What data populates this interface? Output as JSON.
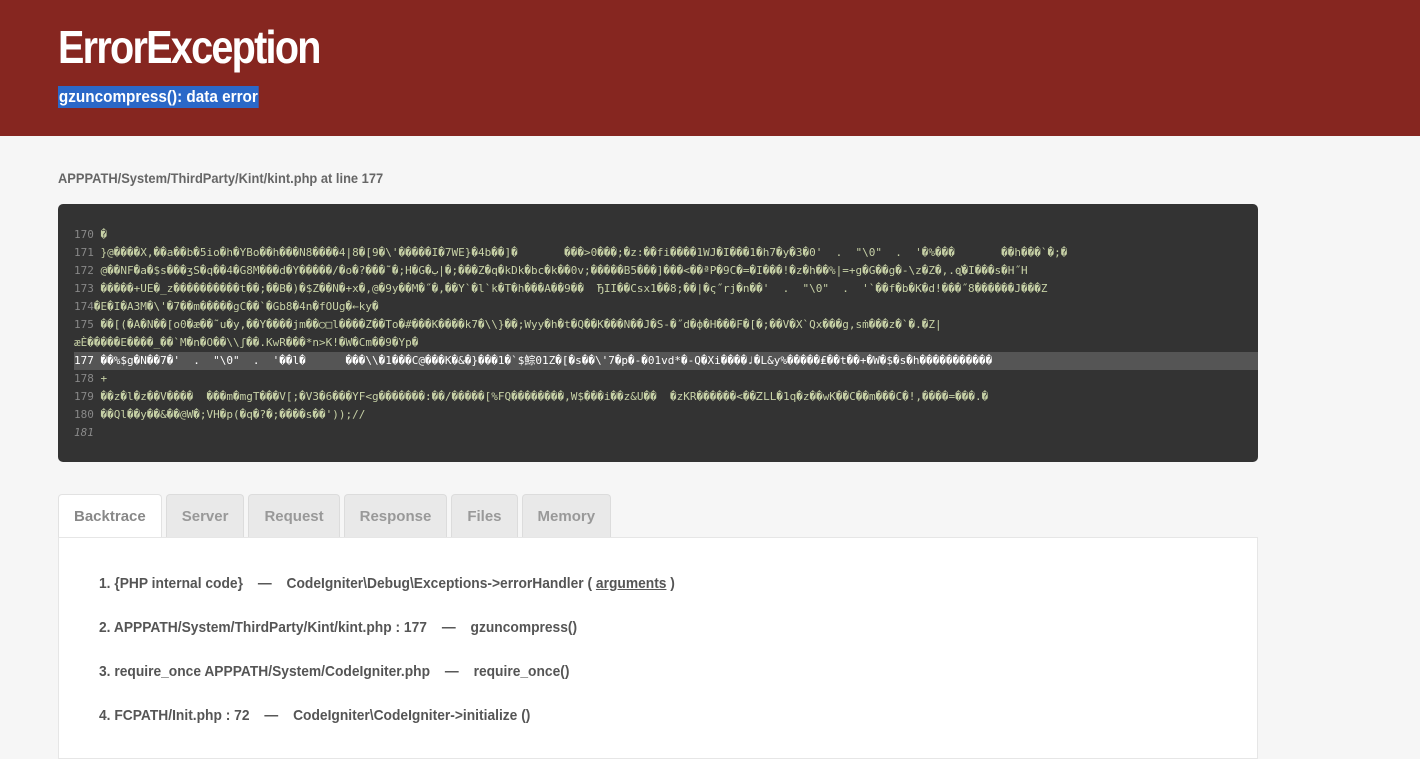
{
  "header": {
    "title": "ErrorException",
    "message": "gzuncompress(): data error"
  },
  "source": {
    "path": "APPPATH/System/ThirdParty/Kint/kint.php at line 177",
    "lines": [
      {
        "num": "170",
        "code": "�"
      },
      {
        "num": "171",
        "code": "}@����X,��a��b�5io�h�YBo��h���N8����4|8�[9�\\'�����I�7WE}�4b��]�       ���>0���;�z:��fi����1WJ�I���1�h7�y�3�0'  .  \"\\0\"  .  '�%���       ��h���`�;�"
      },
      {
        "num": "172",
        "code": "@��NF�a�$s���ʒS�q��4�G8M���d�Y�����/�o�?���˜�;H�G�ب|�;���Z�q�kDk�bc�k��0v;�����B5���]���<��ªP�9C�=�I���!�z�h��%|=+g�G��g�-\\z�Z�,.q҉�I���s�H˝H"
      },
      {
        "num": "173",
        "code": "�����+UE�_z����������t��;��B�)�$Z��N�+x�,@�9y��M�˝�,��Y`�l`k�T�h���A��9��  ЂII��Csx1��8;��|�ς˝rj�n��'  .  \"\\0\"  .  '`��f�b�K�d!���˝8������J���Z"
      },
      {
        "num": "174",
        "code": "�E�I�A3M�\\'�7��m�����gC��`�Gb8�4n�fOUg�←ky�"
      },
      {
        "num": "175",
        "code": "��[(�A�N��[o0�æ��˜u�y,��Y����jm��○□l����Z��To�#���K����k7�\\\\}��;Wyy�h�t�Q��K���N��J�S-�˝d�ф�H���F�[�;��V�X`Qx���g,sṁ���z�`�.�Z|"
      },
      {
        "num": "",
        "code": "æÈ�����E����_��`M�n�O��\\\\ʃ��.KwR���*n>K!�W�Cm��9�Yp�"
      },
      {
        "num": "177",
        "code": "��%$g�N��7�'  .  \"\\0\"  .  '��l�      ���\\\\�1���C@���K�&�}���1�`$鯮01Z�[�s��\\'7�p�-�01vd*�-Q�Xi����♩�L&y%�����₤��t��+�W�$�s�h�����������"
      },
      {
        "num": "178",
        "code": "+"
      },
      {
        "num": "179",
        "code": "��z�l�z��V����  ���m�mgT���V[;�V3�6���YF<g�������:��/�����[%FQ��������,W$���i��z&U��  �zKR������<��ᏃLL�1q�z��wK��C��m���C�!,����=���.�"
      },
      {
        "num": "180",
        "code": "��Ql��y��&��@W�;VH�p(�q�?�;����s��'));//"
      },
      {
        "num": "181",
        "code": ""
      }
    ]
  },
  "tabs": [
    {
      "label": "Backtrace",
      "active": true
    },
    {
      "label": "Server",
      "active": false
    },
    {
      "label": "Request",
      "active": false
    },
    {
      "label": "Response",
      "active": false
    },
    {
      "label": "Files",
      "active": false
    },
    {
      "label": "Memory",
      "active": false
    }
  ],
  "backtrace": [
    {
      "num": "1.",
      "file": "{PHP internal code}",
      "func": "CodeIgniter\\Debug\\Exceptions->errorHandler (",
      "link": "arguments",
      "tail": ")"
    },
    {
      "num": "2.",
      "file": "APPPATH/System/ThirdParty/Kint/kint.php : 177",
      "func": "gzuncompress()",
      "link": "",
      "tail": ""
    },
    {
      "num": "3.",
      "file": "require_once APPPATH/System/CodeIgniter.php",
      "func": "require_once()",
      "link": "",
      "tail": ""
    },
    {
      "num": "4.",
      "file": "FCPATH/Init.php : 72",
      "func": "CodeIgniter\\CodeIgniter->initialize ()",
      "link": "",
      "tail": ""
    }
  ],
  "colors": {
    "header_bg": "#862620",
    "selection": "#2a68c8",
    "code_bg": "#333333"
  }
}
